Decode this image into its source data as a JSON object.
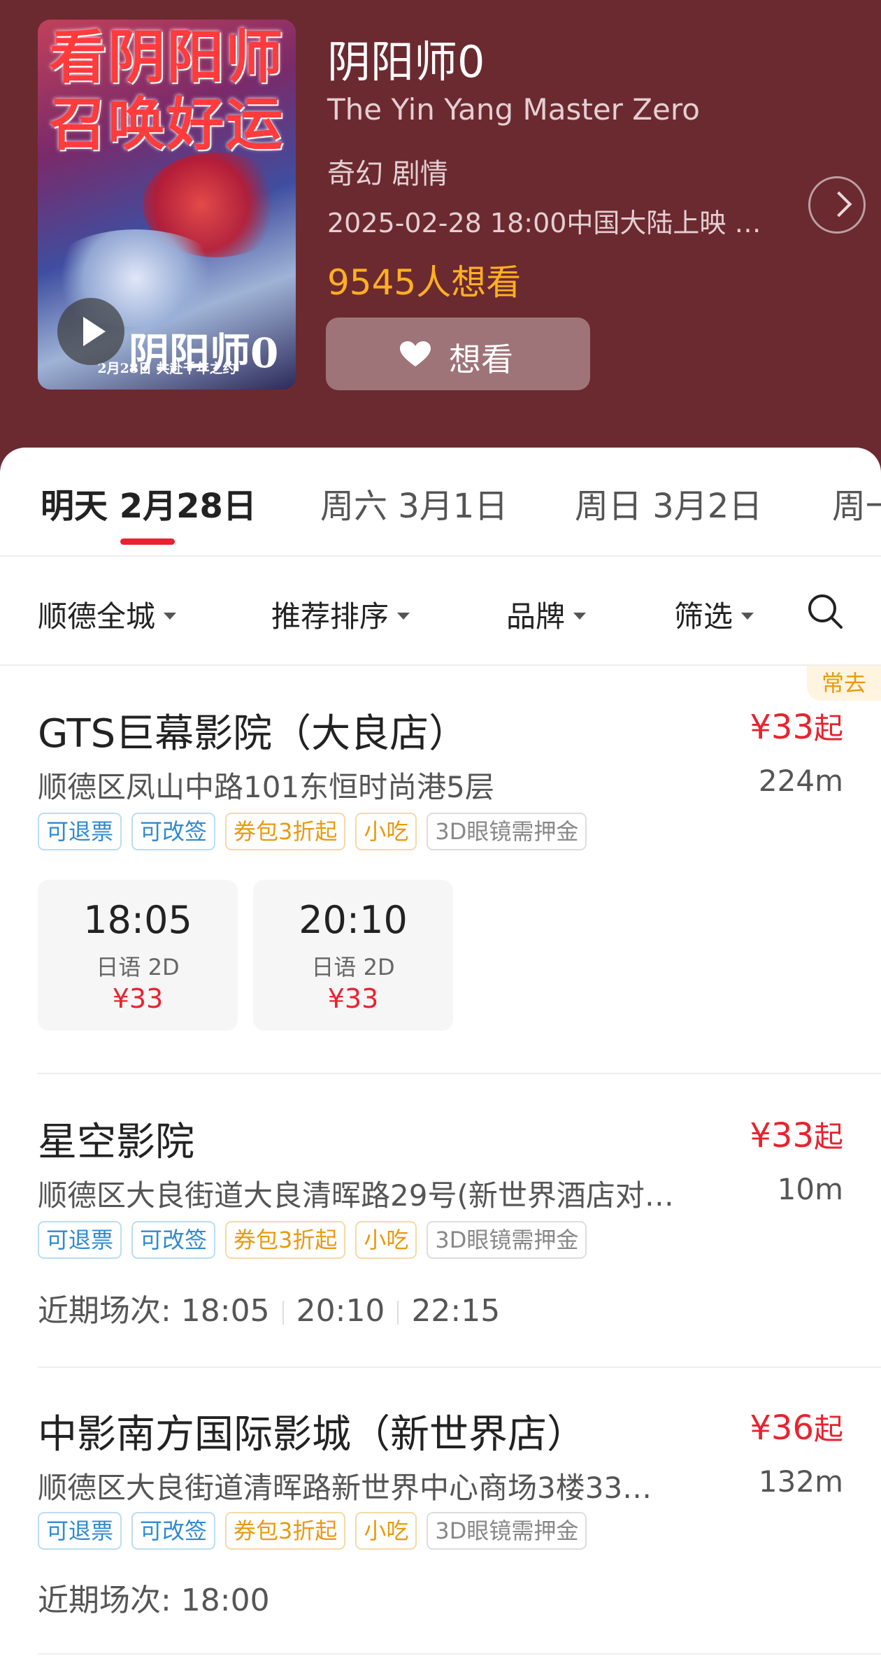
{
  "movie": {
    "poster_title": "看阴阳师召唤好运",
    "poster_logo": "阴阳师0",
    "poster_tagline": "2月28日 共赴千年之约",
    "title": "阴阳师0",
    "english_title": "The Yin Yang Master Zero",
    "genres": "奇幻 剧情",
    "release": "2025-02-28 18:00中国大陆上映 …",
    "want_count": "9545人想看",
    "want_button": "想看"
  },
  "date_tabs": [
    {
      "label": "明天 2月28日"
    },
    {
      "label": "周六 3月1日"
    },
    {
      "label": "周日 3月2日"
    },
    {
      "label": "周一"
    }
  ],
  "filters": {
    "area": "顺德全城",
    "sort": "推荐排序",
    "brand": "品牌",
    "filter": "筛选"
  },
  "frequent_badge": "常去",
  "cinemas": [
    {
      "name": "GTS巨幕影院（大良店）",
      "price": "¥33",
      "price_suffix": "起",
      "address": "顺德区凤山中路101东恒时尚港5层",
      "distance": "224m",
      "tags": [
        "可退票",
        "可改签",
        "券包3折起",
        "小吃",
        "3D眼镜需押金"
      ],
      "showtimes": [
        {
          "time": "18:05",
          "lang": "日语 2D",
          "price": "¥33"
        },
        {
          "time": "20:10",
          "lang": "日语 2D",
          "price": "¥33"
        }
      ]
    },
    {
      "name": "星空影院",
      "price": "¥33",
      "price_suffix": "起",
      "address": "顺德区大良街道大良清晖路29号(新世界酒店对…",
      "distance": "10m",
      "tags": [
        "可退票",
        "可改签",
        "券包3折起",
        "小吃",
        "3D眼镜需押金"
      ],
      "recent_label": "近期场次: 18:05",
      "recent_more": [
        "20:10",
        "22:15"
      ]
    },
    {
      "name": "中影南方国际影城（新世界店）",
      "price": "¥36",
      "price_suffix": "起",
      "address": "顺德区大良街道清晖路新世界中心商场3楼33…",
      "distance": "132m",
      "tags": [
        "可退票",
        "可改签",
        "券包3折起",
        "小吃",
        "3D眼镜需押金"
      ],
      "recent_label": "近期场次: 18:00"
    }
  ],
  "colors": {
    "header_bg": "#6b2a30",
    "accent_red": "#e8232f",
    "want_orange": "#ffb020",
    "tag_blue": "#2f8ad0",
    "tag_orange": "#e89a10"
  }
}
